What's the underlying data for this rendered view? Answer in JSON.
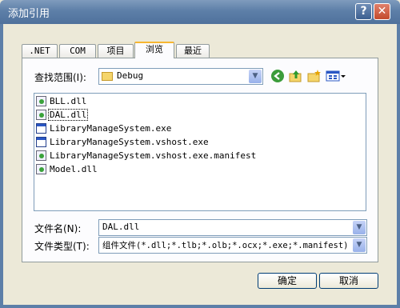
{
  "window": {
    "title": "添加引用"
  },
  "tabs": [
    {
      "label": ".NET"
    },
    {
      "label": "COM"
    },
    {
      "label": "项目"
    },
    {
      "label": "浏览",
      "active": true
    },
    {
      "label": "最近"
    }
  ],
  "lookin": {
    "label": "查找范围(I):",
    "value": "Debug"
  },
  "toolbar_icons": [
    "back-icon",
    "up-folder-icon",
    "new-folder-icon",
    "view-menu-icon"
  ],
  "files": [
    {
      "name": "BLL.dll",
      "type": "dll"
    },
    {
      "name": "DAL.dll",
      "type": "dll",
      "selected": true
    },
    {
      "name": "LibraryManageSystem.exe",
      "type": "exe"
    },
    {
      "name": "LibraryManageSystem.vshost.exe",
      "type": "exe"
    },
    {
      "name": "LibraryManageSystem.vshost.exe.manifest",
      "type": "dll"
    },
    {
      "name": "Model.dll",
      "type": "dll"
    }
  ],
  "filename": {
    "label": "文件名(N):",
    "value": "DAL.dll"
  },
  "filetype": {
    "label": "文件类型(T):",
    "value": "组件文件(*.dll;*.tlb;*.olb;*.ocx;*.exe;*.manifest)"
  },
  "buttons": {
    "ok": "确定",
    "cancel": "取消"
  },
  "colors": {
    "titlebar": "#5d7fa8",
    "dialog": "#ece9d8",
    "active_tab_accent": "#f7b631"
  }
}
